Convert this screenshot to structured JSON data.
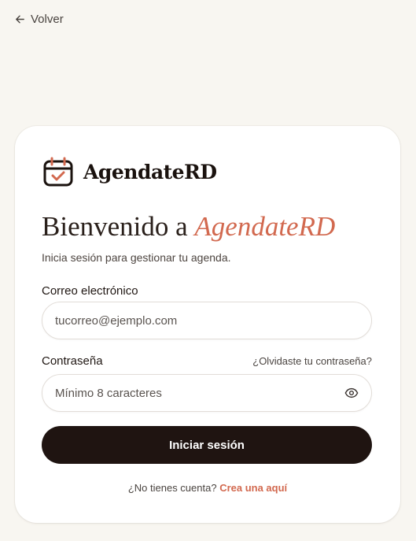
{
  "nav": {
    "back_label": "Volver"
  },
  "brand": {
    "name": "AgendateRD"
  },
  "hero": {
    "headline_prefix": "Bienvenido a ",
    "headline_accent": "AgendateRD",
    "subtitle": "Inicia sesión para gestionar tu agenda."
  },
  "form": {
    "email": {
      "label": "Correo electrónico",
      "placeholder": "tucorreo@ejemplo.com",
      "value": ""
    },
    "password": {
      "label": "Contraseña",
      "placeholder": "Mínimo 8 caracteres",
      "value": "",
      "forgot_label": "¿Olvidaste tu contraseña?"
    },
    "submit_label": "Iniciar sesión"
  },
  "footer": {
    "prompt": "¿No tienes cuenta?",
    "link_label": "Crea una aquí"
  },
  "colors": {
    "accent": "#d2694f",
    "primary": "#1f1411",
    "background": "#f8f6f1"
  },
  "icons": {
    "back": "arrow-left-icon",
    "logo": "calendar-check-icon",
    "toggle_password": "eye-icon"
  }
}
